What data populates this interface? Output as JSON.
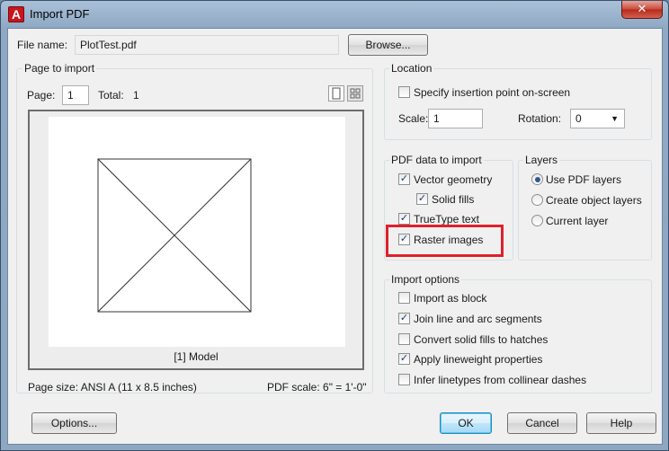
{
  "window": {
    "title": "Import PDF",
    "close_glyph": "✕",
    "app_icon_letter": "A"
  },
  "file": {
    "label": "File name:",
    "value": "PlotTest.pdf",
    "browse_label": "Browse..."
  },
  "page_to_import": {
    "title": "Page to import",
    "page_label": "Page:",
    "page_value": "1",
    "total_label": "Total:",
    "total_value": "1",
    "preview_caption": "[1] Model",
    "page_size": "Page size:  ANSI A (11 x 8.5 inches)",
    "pdf_scale": "PDF scale:  6\" = 1'-0\""
  },
  "location": {
    "title": "Location",
    "specify_label": "Specify insertion point on-screen",
    "specify_checked": false,
    "scale_label": "Scale:",
    "scale_value": "1",
    "rotation_label": "Rotation:",
    "rotation_value": "0"
  },
  "pdf_data": {
    "title": "PDF data to import",
    "vector_label": "Vector geometry",
    "solid_fills_label": "Solid fills",
    "truetype_label": "TrueType text",
    "raster_label": "Raster images"
  },
  "layers": {
    "title": "Layers",
    "use_pdf_label": "Use PDF layers",
    "create_object_label": "Create object layers",
    "current_label": "Current layer"
  },
  "import_options": {
    "title": "Import options",
    "as_block_label": "Import as block",
    "join_label": "Join line and arc segments",
    "convert_label": "Convert solid fills to hatches",
    "lineweight_label": "Apply lineweight properties",
    "infer_label": "Infer linetypes from collinear dashes"
  },
  "buttons": {
    "options": "Options...",
    "ok": "OK",
    "cancel": "Cancel",
    "help": "Help"
  },
  "check_glyph": "✓",
  "colors": {
    "highlight": "#e0202a",
    "accent": "#3c7fb1"
  }
}
